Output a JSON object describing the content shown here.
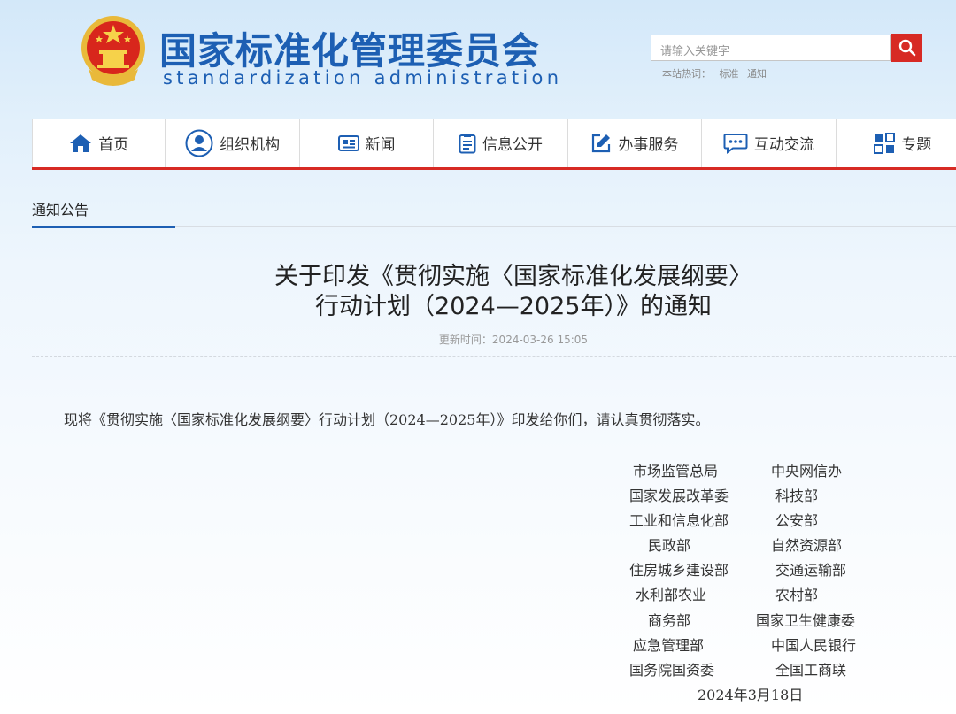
{
  "header": {
    "site_name_cn": "国家标准化管理委员会",
    "site_name_en": "standardization administration",
    "search_placeholder": "请输入关键字",
    "hotwords_label": "本站热词：",
    "hotwords": [
      "标准",
      "通知"
    ]
  },
  "nav": {
    "items": [
      {
        "label": "首页",
        "icon": "home-icon"
      },
      {
        "label": "组织机构",
        "icon": "person-icon"
      },
      {
        "label": "新闻",
        "icon": "newspaper-icon"
      },
      {
        "label": "信息公开",
        "icon": "clipboard-icon"
      },
      {
        "label": "办事服务",
        "icon": "edit-icon"
      },
      {
        "label": "互动交流",
        "icon": "chat-icon"
      },
      {
        "label": "专题",
        "icon": "topics-icon"
      }
    ]
  },
  "breadcrumb": {
    "current": "通知公告"
  },
  "article": {
    "title_line1": "关于印发《贯彻实施〈国家标准化发展纲要〉",
    "title_line2": "行动计划（2024—2025年）》的通知",
    "update_time": "更新时间：2024-03-26 15:05",
    "body": "现将《贯彻实施〈国家标准化发展纲要〉行动计划（2024—2025年）》印发给你们，请认真贯彻落实。",
    "signatories_left": [
      "市场监管总局",
      "国家发展改革委",
      "工业和信息化部",
      "民政部",
      "住房城乡建设部",
      "水利部农业",
      "商务部",
      "应急管理部",
      "国务院国资委"
    ],
    "signatories_right": [
      "中央网信办",
      "科技部",
      "公安部",
      "自然资源部",
      "交通运输部",
      "农村部",
      "国家卫生健康委",
      "中国人民银行",
      "全国工商联"
    ],
    "date": "2024年3月18日"
  },
  "colors": {
    "brand_blue": "#1d5fb3",
    "accent_red": "#d72a24"
  }
}
